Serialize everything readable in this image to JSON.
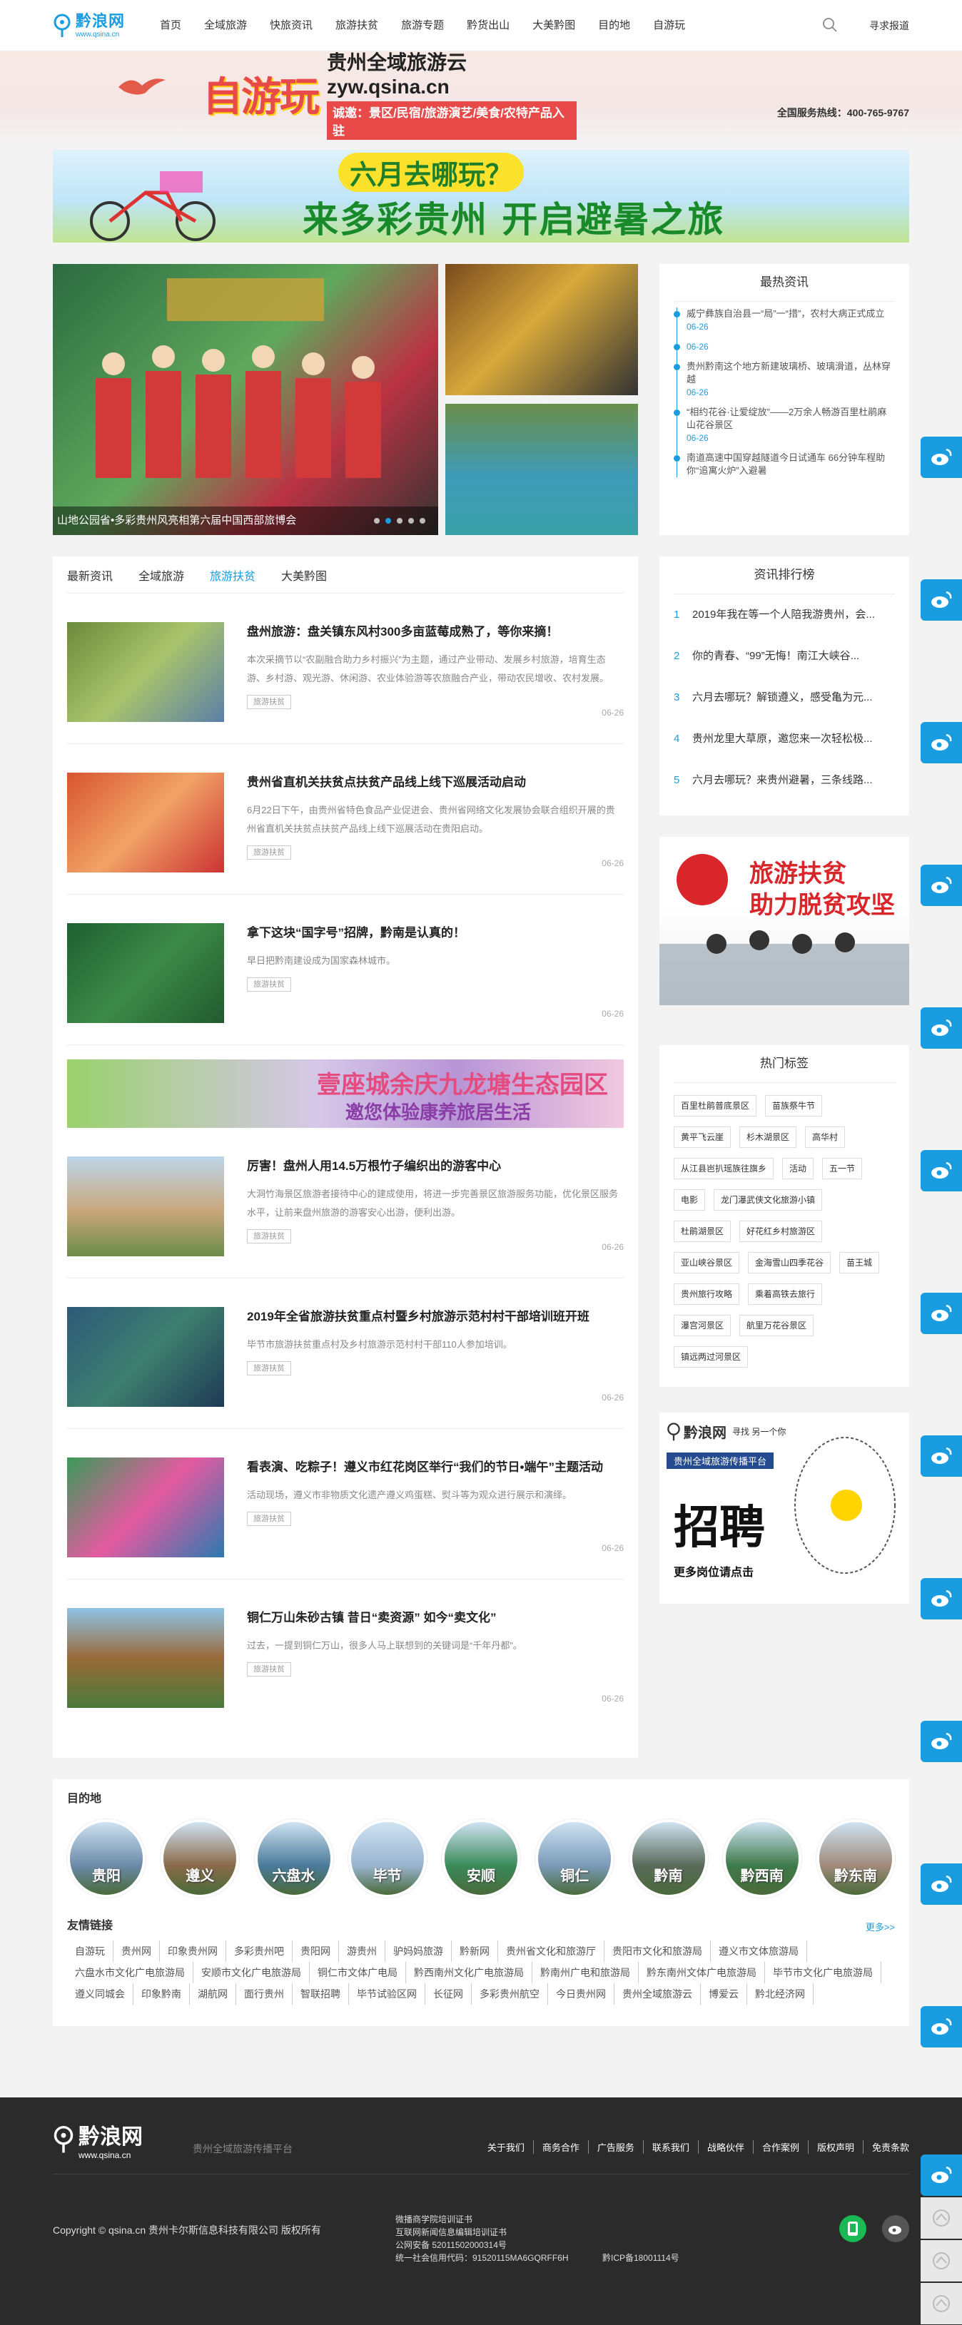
{
  "header": {
    "logo_cn": "黔浪网",
    "logo_en": "www.qsina.cn",
    "nav": [
      "首页",
      "全域旅游",
      "快旅资讯",
      "旅游扶贫",
      "旅游专题",
      "黔货出山",
      "大美黔图",
      "目的地",
      "自游玩"
    ],
    "seek_report": "寻求报道"
  },
  "top_ad": {
    "big": "自游玩",
    "title": "贵州全域旅游云 zyw.qsina.cn",
    "sub": "诚邀：景区/民宿/旅游演艺/美食/农特产品入驻",
    "hotline": "全国服务热线：400-765-9767"
  },
  "banner_ad": {
    "question": "六月去哪玩？",
    "main": "来多彩贵州 开启避暑之旅"
  },
  "slider": {
    "caption": "山地公园省•多彩贵州风亮相第六届中国西部旅博会",
    "dots": 5,
    "active_dot": 1
  },
  "latest_news": {
    "title": "最热资讯",
    "items": [
      {
        "text": "威宁彝族自治县一“局”一“措”，农村大病正式成立",
        "date": "06-26"
      },
      {
        "text": "06-26",
        "date": ""
      },
      {
        "text": "贵州黔南这个地方新建玻璃桥、玻璃滑道，丛林穿越",
        "date": "06-26"
      },
      {
        "text": "“相约花谷·让爱绽放”——2万余人畅游百里杜鹃麻山花谷景区",
        "date": "06-26"
      },
      {
        "text": "南道高速中国穿越隧道今日试通车 66分钟车程助你“追寓火炉”入避暑",
        "date": ""
      }
    ]
  },
  "tabs": [
    "最新资讯",
    "全域旅游",
    "旅游扶贫",
    "大美黔图"
  ],
  "active_tab": 2,
  "articles": [
    {
      "title": "盘州旅游：盘关镇东风村300多亩蓝莓成熟了，等你来摘！",
      "summary": "本次采摘节以“农副融合助力乡村振兴”为主题，通过产业带动、发展乡村旅游，培育生态游、乡村游、观光游、休闲游、农业体验游等农旅融合产业，带动农民增收、农村发展。",
      "tag": "旅游扶贫",
      "date": "06-26"
    },
    {
      "title": "贵州省直机关扶贫点扶贫产品线上线下巡展活动启动",
      "summary": "6月22日下午，由贵州省特色食品产业促进会、贵州省网络文化发展协会联合组织开展的贵州省直机关扶贫点扶贫产品线上线下巡展活动在贵阳启动。",
      "tag": "旅游扶贫",
      "date": "06-26"
    },
    {
      "title": "拿下这块“国字号”招牌，黔南是认真的！",
      "summary": "早日把黔南建设成为国家森林城市。",
      "tag": "旅游扶贫",
      "date": "06-26"
    },
    {
      "title": "厉害！盘州人用14.5万根竹子编织出的游客中心",
      "summary": "大洞竹海景区旅游者接待中心的建成使用，将进一步完善景区旅游服务功能，优化景区服务水平，让前来盘州旅游的游客安心出游，便利出游。",
      "tag": "旅游扶贫",
      "date": "06-26"
    },
    {
      "title": "2019年全省旅游扶贫重点村暨乡村旅游示范村村干部培训班开班",
      "summary": "毕节市旅游扶贫重点村及乡村旅游示范村村干部110人参加培训。",
      "tag": "旅游扶贫",
      "date": "06-26"
    },
    {
      "title": "看表演、吃粽子！遵义市红花岗区举行“我们的节日•端午”主题活动",
      "summary": "活动现场，遵义市非物质文化遗产遵义鸡蛋糕、熨斗等为观众进行展示和演绎。",
      "tag": "旅游扶贫",
      "date": "06-26"
    },
    {
      "title": "铜仁万山朱砂古镇 昔日“卖资源” 如今“卖文化”",
      "summary": "过去，一提到铜仁万山，很多人马上联想到的关键词是“千年丹都”。",
      "tag": "旅游扶贫",
      "date": "06-26"
    }
  ],
  "mid_ad": {
    "a": "壹座城余庆九龙塘生态园区",
    "b": "邀您体验康养旅居生活"
  },
  "ranking": {
    "title": "资讯排行榜",
    "items": [
      "2019年我在等一个人陪我游贵州，会...",
      "你的青春、“99”无悔！南江大峡谷...",
      "六月去哪玩？解锁遵义，感受亀为元...",
      "贵州龙里大草原，邀您来一次轻松极...",
      "六月去哪玩？来贵州避暑，三条线路..."
    ]
  },
  "side_ad": {
    "line1": "旅游扶贫",
    "line2": "助力脱贫攻坚"
  },
  "hot_tags": {
    "title": "热门标签",
    "tags": [
      "百里杜鹃普底景区",
      "苗族祭牛节",
      "黄平飞云崖",
      "杉木湖景区",
      "高华村",
      "从江县岜扒瑶族往旗乡",
      "活动",
      "五一节",
      "电影",
      "龙门瀑武侠文化旅游小镇",
      "杜鹃湖景区",
      "好花红乡村旅游区",
      "亚山峡谷景区",
      "金海雪山四季花谷",
      "苗王城",
      "贵州旅行攻略",
      "乘着高铁去旅行",
      "瀑宫河景区",
      "航里万花谷景区",
      "镇远两过河景区"
    ]
  },
  "recruit": {
    "slogan": "寻找 另一个你",
    "band": "贵州全域旅游传播平台",
    "big": "招聘",
    "more": "更多岗位请点击"
  },
  "destinations": {
    "title": "目的地",
    "items": [
      "贵阳",
      "遵义",
      "六盘水",
      "毕节",
      "安顺",
      "铜仁",
      "黔南",
      "黔西南",
      "黔东南"
    ]
  },
  "friend_links": {
    "title": "友情链接",
    "more": "更多>>",
    "links": [
      "自游玩",
      "贵州网",
      "印象贵州网",
      "多彩贵州吧",
      "贵阳网",
      "游贵州",
      "驴妈妈旅游",
      "黔新网",
      "贵州省文化和旅游厅",
      "贵阳市文化和旅游局",
      "遵义市文体旅游局",
      "六盘水市文化广电旅游局",
      "安顺市文化广电旅游局",
      "铜仁市文体广电局",
      "黔西南州文化广电旅游局",
      "黔南州广电和旅游局",
      "黔东南州文体广电旅游局",
      "毕节市文化广电旅游局",
      "遵义同城会",
      "印象黔南",
      "湖航网",
      "面行贵州",
      "智联招聘",
      "毕节试验区网",
      "长征网",
      "多彩贵州航空",
      "今日贵州网",
      "贵州全域旅游云",
      "博爱云",
      "黔北经济网"
    ]
  },
  "footer": {
    "logo_cn": "黔浪网",
    "logo_en": "www.qsina.cn",
    "slogan": "贵州全域旅游传播平台",
    "links": [
      "关于我们",
      "商务合作",
      "广告服务",
      "联系我们",
      "战略伙伴",
      "合作案例",
      "版权声明",
      "免责条款"
    ],
    "copyright": "Copyright © qsina.cn 贵州卡尔斯信息科技有限公司 版权所有",
    "license": [
      "微播商学院培训证书",
      "互联网新闻信息编辑培训证书",
      "公网安备 52011502000314号",
      "统一社会信用代码：91520115MA6GQRFF6H"
    ],
    "icp": "黔ICP备18001114号"
  },
  "colors": {
    "accent": "#1a9de0",
    "footer_bg": "#2b2b2b",
    "page_bg": "#f3f3f3"
  }
}
